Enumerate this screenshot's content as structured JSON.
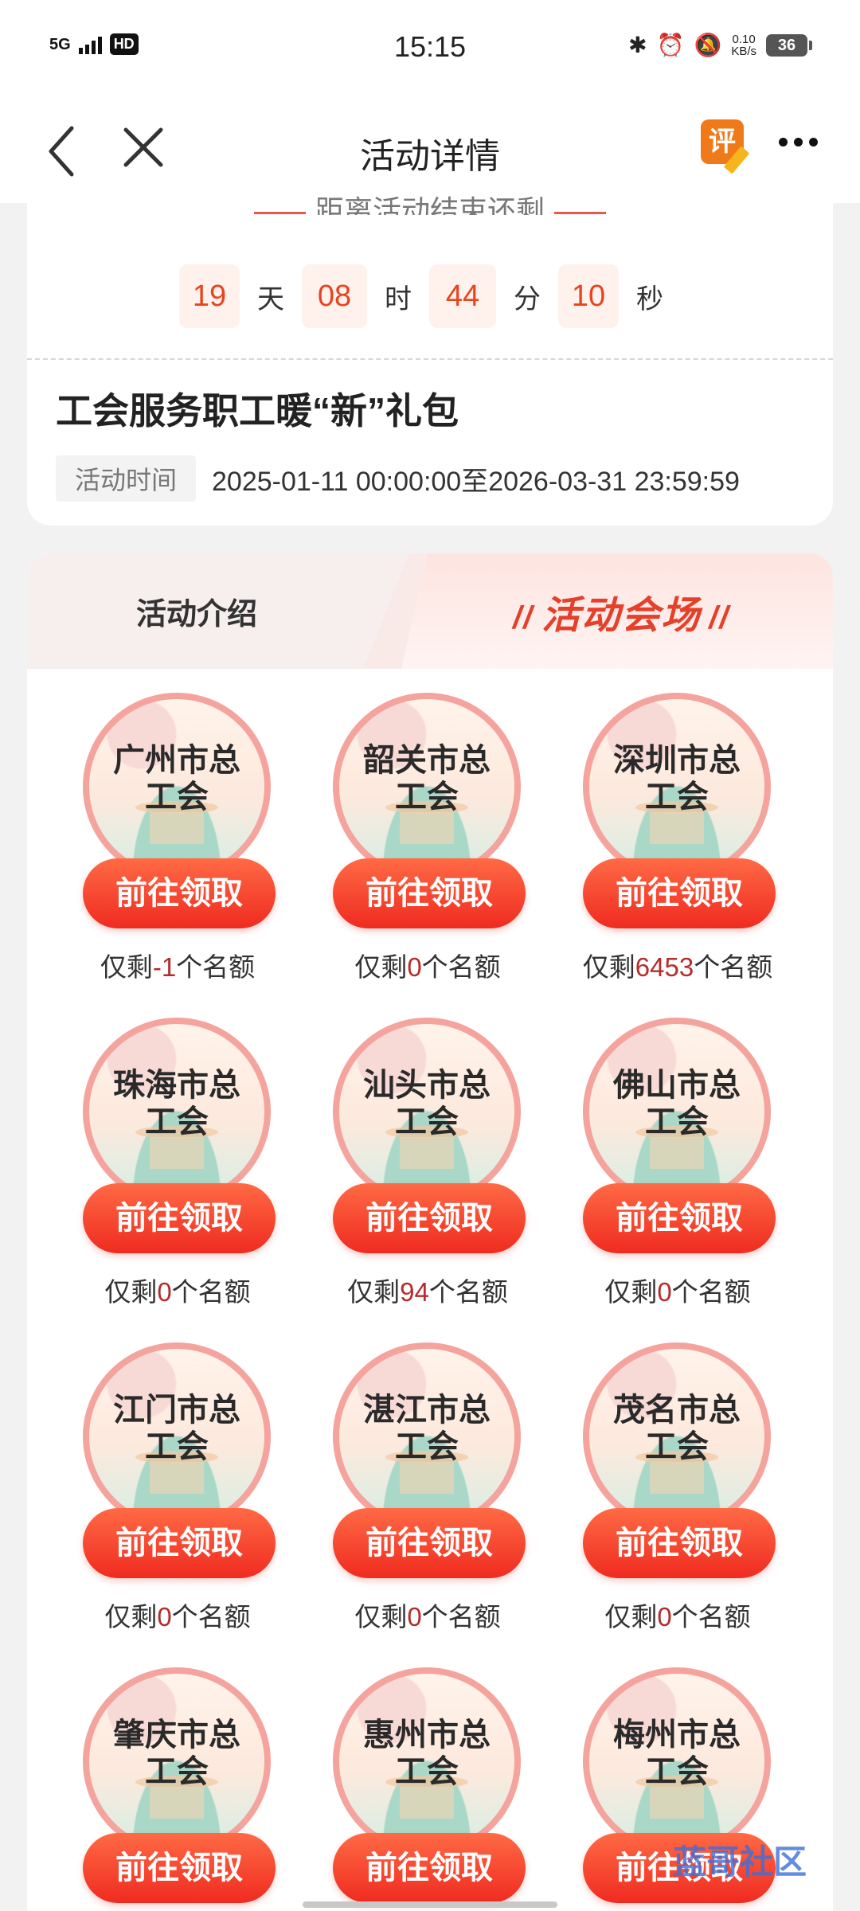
{
  "status_bar": {
    "signal": "5G",
    "hd": "HD",
    "time": "15:15",
    "speed_value": "0.10",
    "speed_unit": "KB/s",
    "battery": "36"
  },
  "nav": {
    "title": "活动详情",
    "review_icon_text": "评"
  },
  "countdown": {
    "title": "距离活动结束还剩",
    "days": "19",
    "days_unit": "天",
    "hours": "08",
    "hours_unit": "时",
    "minutes": "44",
    "minutes_unit": "分",
    "seconds": "10",
    "seconds_unit": "秒"
  },
  "activity": {
    "title": "工会服务职工暖“新”礼包",
    "time_label": "活动时间",
    "time_value": "2025-01-11 00:00:00至2026-03-31 23:59:59"
  },
  "tabs": {
    "intro": "活动介绍",
    "venue": "活动会场"
  },
  "venues": [
    {
      "name_line1": "广州市总",
      "name_line2": "工会",
      "button": "前往领取",
      "quota_prefix": "仅剩",
      "quota": "-1",
      "quota_suffix": "个名额"
    },
    {
      "name_line1": "韶关市总",
      "name_line2": "工会",
      "button": "前往领取",
      "quota_prefix": "仅剩",
      "quota": "0",
      "quota_suffix": "个名额"
    },
    {
      "name_line1": "深圳市总",
      "name_line2": "工会",
      "button": "前往领取",
      "quota_prefix": "仅剩",
      "quota": "6453",
      "quota_suffix": "个名额"
    },
    {
      "name_line1": "珠海市总",
      "name_line2": "工会",
      "button": "前往领取",
      "quota_prefix": "仅剩",
      "quota": "0",
      "quota_suffix": "个名额"
    },
    {
      "name_line1": "汕头市总",
      "name_line2": "工会",
      "button": "前往领取",
      "quota_prefix": "仅剩",
      "quota": "94",
      "quota_suffix": "个名额"
    },
    {
      "name_line1": "佛山市总",
      "name_line2": "工会",
      "button": "前往领取",
      "quota_prefix": "仅剩",
      "quota": "0",
      "quota_suffix": "个名额"
    },
    {
      "name_line1": "江门市总",
      "name_line2": "工会",
      "button": "前往领取",
      "quota_prefix": "仅剩",
      "quota": "0",
      "quota_suffix": "个名额"
    },
    {
      "name_line1": "湛江市总",
      "name_line2": "工会",
      "button": "前往领取",
      "quota_prefix": "仅剩",
      "quota": "0",
      "quota_suffix": "个名额"
    },
    {
      "name_line1": "茂名市总",
      "name_line2": "工会",
      "button": "前往领取",
      "quota_prefix": "仅剩",
      "quota": "0",
      "quota_suffix": "个名额"
    },
    {
      "name_line1": "肇庆市总",
      "name_line2": "工会",
      "button": "前往领取"
    },
    {
      "name_line1": "惠州市总",
      "name_line2": "工会",
      "button": "前往领取"
    },
    {
      "name_line1": "梅州市总",
      "name_line2": "工会",
      "button": "前往领取"
    }
  ],
  "watermark": "蓝哥社区"
}
